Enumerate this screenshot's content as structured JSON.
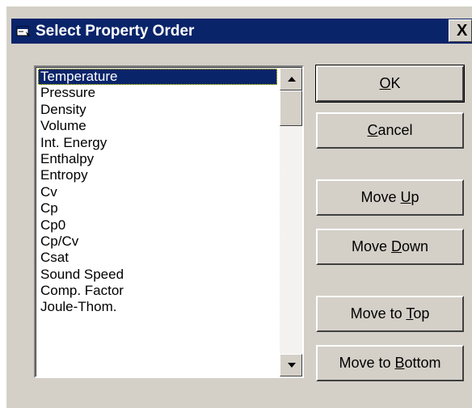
{
  "window": {
    "title": "Select Property Order",
    "close_label": "X"
  },
  "properties": {
    "items": [
      "Temperature",
      "Pressure",
      "Density",
      "Volume",
      "Int. Energy",
      "Enthalpy",
      "Entropy",
      "Cv",
      "Cp",
      "Cp0",
      "Cp/Cv",
      "Csat",
      "Sound Speed",
      "Comp. Factor",
      "Joule-Thom."
    ],
    "selected": "Temperature"
  },
  "buttons": {
    "ok": {
      "pre": "",
      "key": "O",
      "post": "K"
    },
    "cancel": {
      "pre": "",
      "key": "C",
      "post": "ancel"
    },
    "move_up": {
      "pre": "Move ",
      "key": "U",
      "post": "p"
    },
    "move_down": {
      "pre": "Move ",
      "key": "D",
      "post": "own"
    },
    "move_top": {
      "pre": "Move to ",
      "key": "T",
      "post": "op"
    },
    "move_bottom": {
      "pre": "Move to ",
      "key": "B",
      "post": "ottom"
    }
  },
  "colors": {
    "titlebar": "#0a246a",
    "face": "#d4d0c8",
    "selection": "#0a246a"
  },
  "icons": {
    "title": "window-app-icon",
    "scroll_up": "up-arrow-icon",
    "scroll_down": "down-arrow-icon"
  }
}
